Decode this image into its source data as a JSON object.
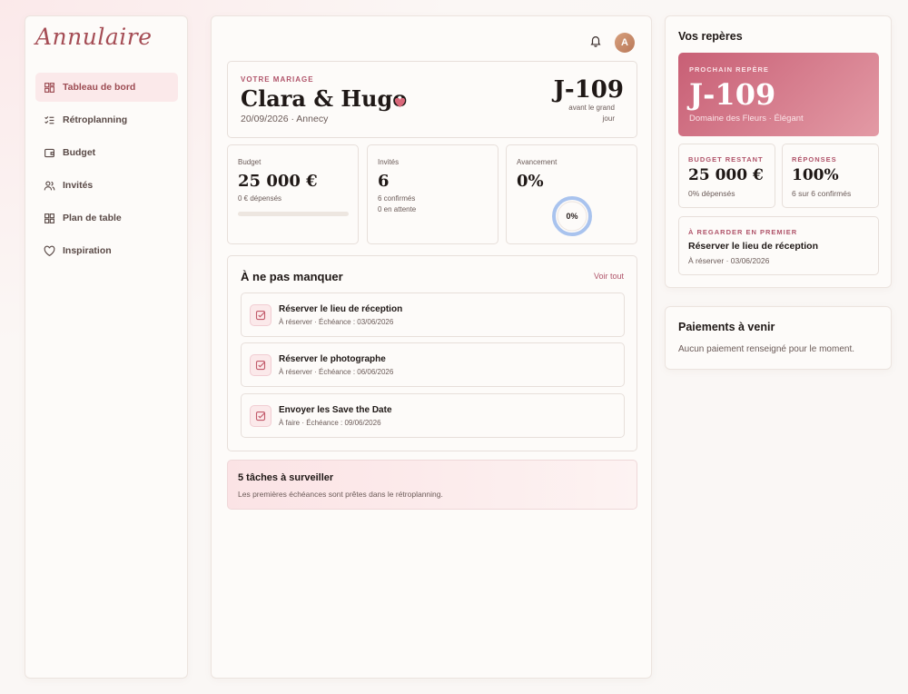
{
  "app": {
    "logo": "Annulaire"
  },
  "sidebar": {
    "items": [
      {
        "label": "Tableau de bord",
        "icon": "dashboard-icon",
        "active": true
      },
      {
        "label": "Rétroplanning",
        "icon": "checklist-icon",
        "active": false
      },
      {
        "label": "Budget",
        "icon": "wallet-icon",
        "active": false
      },
      {
        "label": "Invités",
        "icon": "users-icon",
        "active": false
      },
      {
        "label": "Plan de table",
        "icon": "grid-icon",
        "active": false
      },
      {
        "label": "Inspiration",
        "icon": "heart-icon",
        "active": false
      }
    ]
  },
  "header": {
    "avatar_initial": "A"
  },
  "wedding": {
    "eyebrow": "VOTRE MARIAGE",
    "couple": "Clara & Hugo",
    "date_place": "20/09/2026 · Annecy",
    "countdown": "J-109",
    "countdown_sub": "avant le grand jour"
  },
  "stats": {
    "budget": {
      "label": "Budget",
      "value": "25 000 €",
      "sub": "0 € dépensés",
      "progress": 0
    },
    "guests": {
      "label": "Invités",
      "value": "6",
      "sub1": "6 confirmés",
      "sub2": "0 en attente"
    },
    "progress": {
      "label": "Avancement",
      "value": "0%",
      "ring_label": "0%",
      "percent": 0
    }
  },
  "todo": {
    "title": "À ne pas manquer",
    "see_all": "Voir tout",
    "tasks": [
      {
        "title": "Réserver le lieu de réception",
        "meta": "À réserver · Échéance : 03/06/2026"
      },
      {
        "title": "Réserver le photographe",
        "meta": "À réserver · Échéance : 06/06/2026"
      },
      {
        "title": "Envoyer les Save the Date",
        "meta": "À faire · Échéance : 09/06/2026"
      }
    ]
  },
  "alert": {
    "title": "5 tâches à surveiller",
    "text": "Les premières échéances sont prêtes dans le rétroplanning."
  },
  "landmarks": {
    "title": "Vos repères",
    "next": {
      "eyebrow": "PROCHAIN REPÈRE",
      "value": "J-109",
      "sub": "Domaine des Fleurs · Élégant"
    },
    "budget_left": {
      "eyebrow": "BUDGET RESTANT",
      "value": "25 000 €",
      "sub": "0% dépensés"
    },
    "replies": {
      "eyebrow": "RÉPONSES",
      "value": "100%",
      "sub": "6 sur 6 confirmés"
    },
    "first": {
      "eyebrow": "À REGARDER EN PREMIER",
      "title": "Réserver le lieu de réception",
      "meta": "À réserver · 03/06/2026"
    }
  },
  "payments": {
    "title": "Paiements à venir",
    "text": "Aucun paiement renseigné pour le moment."
  },
  "colors": {
    "accent": "#b0546a",
    "accent_soft": "#fbe9ea",
    "ring": "#a9c3ee"
  }
}
